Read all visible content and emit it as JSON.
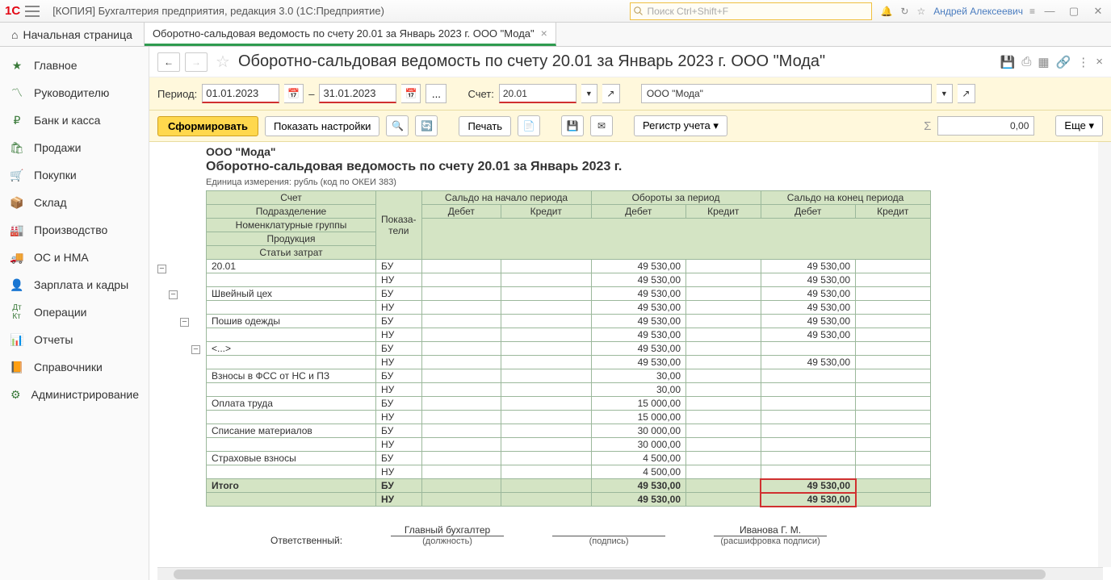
{
  "titlebar": {
    "app_title": "[КОПИЯ] Бухгалтерия предприятия, редакция 3.0  (1С:Предприятие)",
    "search_placeholder": "Поиск Ctrl+Shift+F",
    "user": "Андрей Алексеевич"
  },
  "tabs": {
    "home": "Начальная страница",
    "active": "Оборотно-сальдовая ведомость по счету 20.01 за Январь 2023 г. ООО \"Мода\""
  },
  "sidebar": [
    "Главное",
    "Руководителю",
    "Банк и касса",
    "Продажи",
    "Покупки",
    "Склад",
    "Производство",
    "ОС и НМА",
    "Зарплата и кадры",
    "Операции",
    "Отчеты",
    "Справочники",
    "Администрирование"
  ],
  "page": {
    "title": "Оборотно-сальдовая ведомость по счету 20.01 за Январь 2023 г. ООО \"Мода\""
  },
  "params": {
    "period_label": "Период:",
    "date_from": "01.01.2023",
    "dash": "–",
    "date_to": "31.01.2023",
    "account_label": "Счет:",
    "account": "20.01",
    "org": "ООО \"Мода\""
  },
  "toolbar": {
    "form": "Сформировать",
    "show_settings": "Показать настройки",
    "print": "Печать",
    "register": "Регистр учета",
    "sigma": "Σ",
    "sum": "0,00",
    "more": "Еще"
  },
  "report": {
    "org": "ООО \"Мода\"",
    "title": "Оборотно-сальдовая ведомость по счету 20.01 за Январь 2023 г.",
    "unit": "Единица измерения: рубль (код по ОКЕИ 383)",
    "head": {
      "col_account": "Счет",
      "col_ind": "Показа-\nтели",
      "start": "Сальдо на начало периода",
      "turn": "Обороты за период",
      "end": "Сальдо на конец периода",
      "debit": "Дебет",
      "credit": "Кредит",
      "sub1": "Подразделение",
      "sub2": "Номенклатурные группы",
      "sub3": "Продукция",
      "sub4": "Статьи затрат"
    },
    "rows": [
      {
        "label": "20.01",
        "ind": "БУ",
        "t_d": "49 530,00",
        "e_d": "49 530,00",
        "cls": ""
      },
      {
        "label": "",
        "ind": "НУ",
        "t_d": "49 530,00",
        "e_d": "49 530,00",
        "cls": ""
      },
      {
        "label": "Швейный цех",
        "ind": "БУ",
        "t_d": "49 530,00",
        "e_d": "49 530,00",
        "cls": "indent1"
      },
      {
        "label": "",
        "ind": "НУ",
        "t_d": "49 530,00",
        "e_d": "49 530,00",
        "cls": ""
      },
      {
        "label": "Пошив одежды",
        "ind": "БУ",
        "t_d": "49 530,00",
        "e_d": "49 530,00",
        "cls": "indent2"
      },
      {
        "label": "",
        "ind": "НУ",
        "t_d": "49 530,00",
        "e_d": "49 530,00",
        "cls": ""
      },
      {
        "label": "<...>",
        "ind": "БУ",
        "t_d": "49 530,00",
        "e_d": "",
        "cls": "indent3"
      },
      {
        "label": "",
        "ind": "НУ",
        "t_d": "49 530,00",
        "e_d": "49 530,00",
        "cls": ""
      },
      {
        "label": "Взносы в ФСС от НС и ПЗ",
        "ind": "БУ",
        "t_d": "30,00",
        "e_d": "",
        "cls": "indent4"
      },
      {
        "label": "",
        "ind": "НУ",
        "t_d": "30,00",
        "e_d": "",
        "cls": ""
      },
      {
        "label": "Оплата труда",
        "ind": "БУ",
        "t_d": "15 000,00",
        "e_d": "",
        "cls": "indent4"
      },
      {
        "label": "",
        "ind": "НУ",
        "t_d": "15 000,00",
        "e_d": "",
        "cls": ""
      },
      {
        "label": "Списание материалов",
        "ind": "БУ",
        "t_d": "30 000,00",
        "e_d": "",
        "cls": "indent4"
      },
      {
        "label": "",
        "ind": "НУ",
        "t_d": "30 000,00",
        "e_d": "",
        "cls": ""
      },
      {
        "label": "Страховые взносы",
        "ind": "БУ",
        "t_d": "4 500,00",
        "e_d": "",
        "cls": "indent4"
      },
      {
        "label": "",
        "ind": "НУ",
        "t_d": "4 500,00",
        "e_d": "",
        "cls": ""
      }
    ],
    "total": {
      "label": "Итого",
      "bu_td": "49 530,00",
      "bu_ed": "49 530,00",
      "nu_td": "49 530,00",
      "nu_ed": "49 530,00"
    }
  },
  "signatures": {
    "resp": "Ответственный:",
    "position": "Главный бухгалтер",
    "position_lbl": "(должность)",
    "sign_lbl": "(подпись)",
    "name": "Иванова Г. М.",
    "name_lbl": "(расшифровка подписи)"
  }
}
